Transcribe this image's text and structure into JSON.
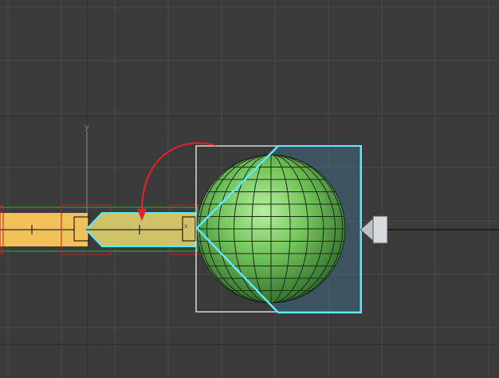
{
  "viewport": {
    "background": "#3b3b3b",
    "grid_color": "#4a4a4a",
    "grid_major_color": "#2f2f2f",
    "axis_labels": {
      "y": "y",
      "x": "x"
    }
  },
  "scene": {
    "bone_chain_color": "#f2c25a",
    "bone_selected_color": "#cfc268",
    "sphere_color": "#6fc05a",
    "sphere_wire_color": "#1c2a1c",
    "selection_highlight_color": "#5fe8ff",
    "bounding_box_color": "#ffffff",
    "red_arrow_color": "#e0202a",
    "light_icon": "light-cone-icon"
  }
}
